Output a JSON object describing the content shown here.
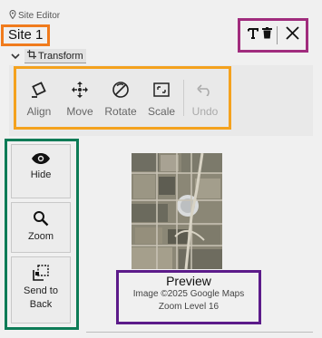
{
  "header": {
    "panel_label": "Site Editor",
    "site_title": "Site 1"
  },
  "right_tools": {
    "text_tool_icon": "text-icon",
    "delete_icon": "trash-icon",
    "close_icon": "close-icon"
  },
  "transform": {
    "label": "Transform",
    "tools": [
      {
        "label": "Align",
        "icon": "align-icon",
        "enabled": true
      },
      {
        "label": "Move",
        "icon": "move-icon",
        "enabled": true
      },
      {
        "label": "Rotate",
        "icon": "rotate-icon",
        "enabled": true
      },
      {
        "label": "Scale",
        "icon": "scale-icon",
        "enabled": true
      },
      {
        "label": "Undo",
        "icon": "undo-icon",
        "enabled": false
      }
    ]
  },
  "side_tools": [
    {
      "label": "Hide",
      "icon": "eye-icon"
    },
    {
      "label": "Zoom",
      "icon": "magnifier-icon"
    },
    {
      "label": "Send to Back",
      "icon": "send-to-back-icon"
    }
  ],
  "preview": {
    "title": "Preview",
    "attribution": "Image ©2025 Google Maps",
    "zoom": "Zoom Level 16"
  },
  "colors": {
    "site_title_highlight": "#f07b1d",
    "right_tools_highlight": "#a02c7d",
    "transform_tools_highlight": "#f4a21e",
    "side_tools_highlight": "#0d7b56",
    "preview_highlight": "#5c1b8a"
  }
}
